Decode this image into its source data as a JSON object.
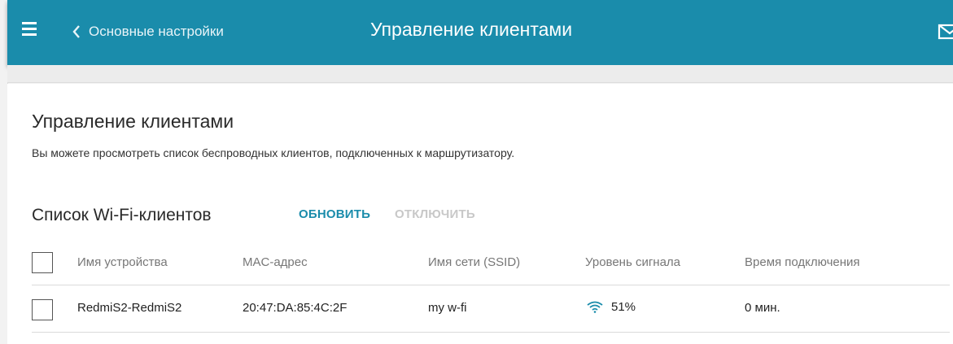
{
  "header": {
    "back_label": "Основные настройки",
    "title": "Управление клиентами",
    "background_color": "#1a8cab",
    "icons": [
      "menu-icon",
      "chevron-left-icon",
      "mail-icon"
    ]
  },
  "section": {
    "title": "Управление клиентами",
    "description": "Вы можете просмотреть список беспроводных клиентов, подключенных к маршрутизатору."
  },
  "clients_list": {
    "title": "Список Wi-Fi-клиентов",
    "refresh_label": "ОБНОВИТЬ",
    "disconnect_label": "ОТКЛЮЧИТЬ",
    "columns": [
      "Имя устройства",
      "MAC-адрес",
      "Имя сети (SSID)",
      "Уровень сигнала",
      "Время подключения"
    ],
    "rows": [
      {
        "device_name": "RedmiS2-RedmiS2",
        "mac": "20:47:DA:85:4C:2F",
        "ssid": "my w-fi",
        "signal": "51%",
        "signal_icon": "wifi-icon",
        "connected_time": "0 мин."
      }
    ]
  }
}
